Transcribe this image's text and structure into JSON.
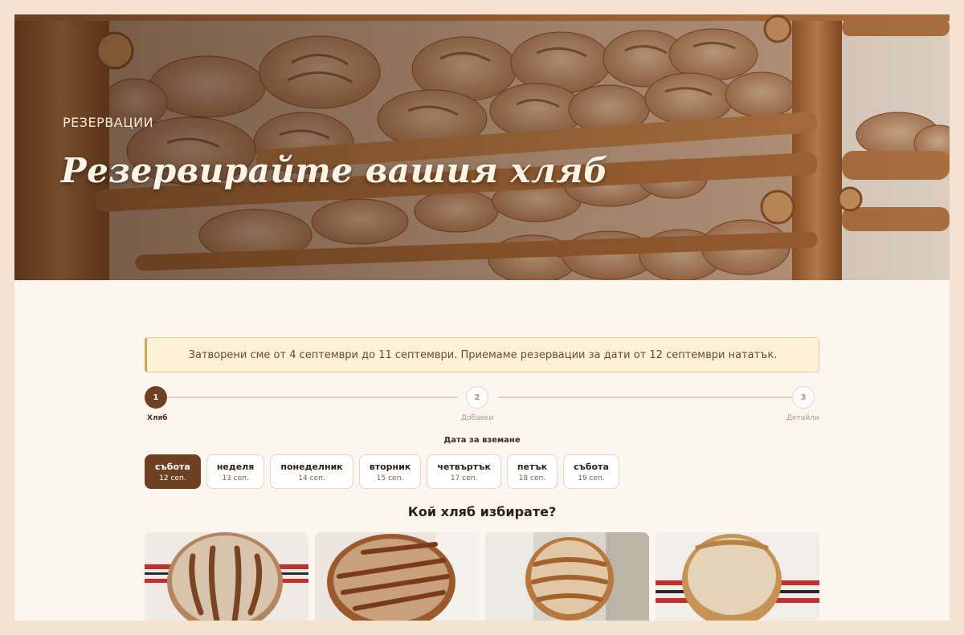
{
  "hero": {
    "kicker": "РЕЗЕРВАЦИИ",
    "title": "Резервирайте вашия хляб"
  },
  "notice": {
    "text": "Затворени сме от 4 септември до 11 септември. Приемаме резервации за дати от 12 септември нататък."
  },
  "steps": [
    {
      "number": "1",
      "label": "Хляб",
      "state": "active"
    },
    {
      "number": "2",
      "label": "Добавки",
      "state": "todo"
    },
    {
      "number": "3",
      "label": "Детайли",
      "state": "todo"
    }
  ],
  "date_picker": {
    "heading": "Дата за вземане",
    "days": [
      {
        "name": "събота",
        "date": "12 сеп.",
        "selected": true
      },
      {
        "name": "неделя",
        "date": "13 сеп.",
        "selected": false
      },
      {
        "name": "понеделник",
        "date": "14 сеп.",
        "selected": false
      },
      {
        "name": "вторник",
        "date": "15 сеп.",
        "selected": false
      },
      {
        "name": "четвъртък",
        "date": "17 сеп.",
        "selected": false
      },
      {
        "name": "петък",
        "date": "18 сеп.",
        "selected": false
      },
      {
        "name": "събота",
        "date": "19 сеп.",
        "selected": false
      }
    ]
  },
  "bread_section": {
    "heading": "Кой хляб избирате?"
  },
  "colors": {
    "accent": "#6e4125",
    "page_bg": "#fdf6ee",
    "outer_bg": "#f3e3cf",
    "notice_bg": "#fdf1d8",
    "notice_border": "#d2a456"
  }
}
